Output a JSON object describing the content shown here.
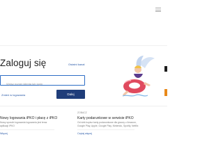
{
  "login": {
    "title": "Zaloguj się",
    "help_link": "Ostatni kanał",
    "input_placeholder": "Wpisz numer klienta lub login",
    "remember_link": "Zmień w logowania",
    "submit_label": "Dalej"
  },
  "cards": [
    {
      "heading": "Nowy logowania iPKO i płacę z iPKO",
      "text_lines": [
        "Nowy sposób logowania logowania jest teraz",
        "aplikacji iPKO"
      ],
      "link": "Więcej"
    },
    {
      "category": "ZOBACZ",
      "heading": "Karty podarunkowe w serwisie iPKO",
      "text_lines": [
        "Od dziś kupisz karty podarunkowe dla graczy z Amazon,",
        "Google Play, Apple, Google Play, Nintendo, Spotify, Netflix"
      ],
      "link": "Czytaj więcej"
    }
  ],
  "colors": {
    "brand_blue": "#1f3d7a",
    "input_border": "#2d6dc5",
    "link": "#2a5aa8",
    "ring": "#e04a5e",
    "accent_orange": "#e8891a"
  }
}
